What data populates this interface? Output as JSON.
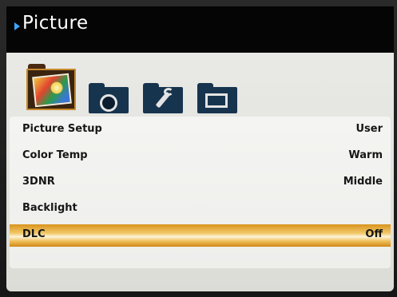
{
  "header": {
    "title": "Picture"
  },
  "category_icons": [
    {
      "name": "picture-folder-icon",
      "selected": true
    },
    {
      "name": "sound-folder-icon",
      "selected": false
    },
    {
      "name": "tools-folder-icon",
      "selected": false
    },
    {
      "name": "screen-folder-icon",
      "selected": false
    }
  ],
  "menu": {
    "items": [
      {
        "label": "Picture Setup",
        "value": "User"
      },
      {
        "label": "Color Temp",
        "value": "Warm"
      },
      {
        "label": "3DNR",
        "value": "Middle"
      },
      {
        "label": "Backlight",
        "value": ""
      },
      {
        "label": "DLC",
        "value": "Off"
      }
    ],
    "selected_index": 4
  },
  "colors": {
    "title_bar": "#050505",
    "panel": "#e5e5e2",
    "highlight": "#f2c969",
    "accent_arrow": "#3da6ff"
  }
}
